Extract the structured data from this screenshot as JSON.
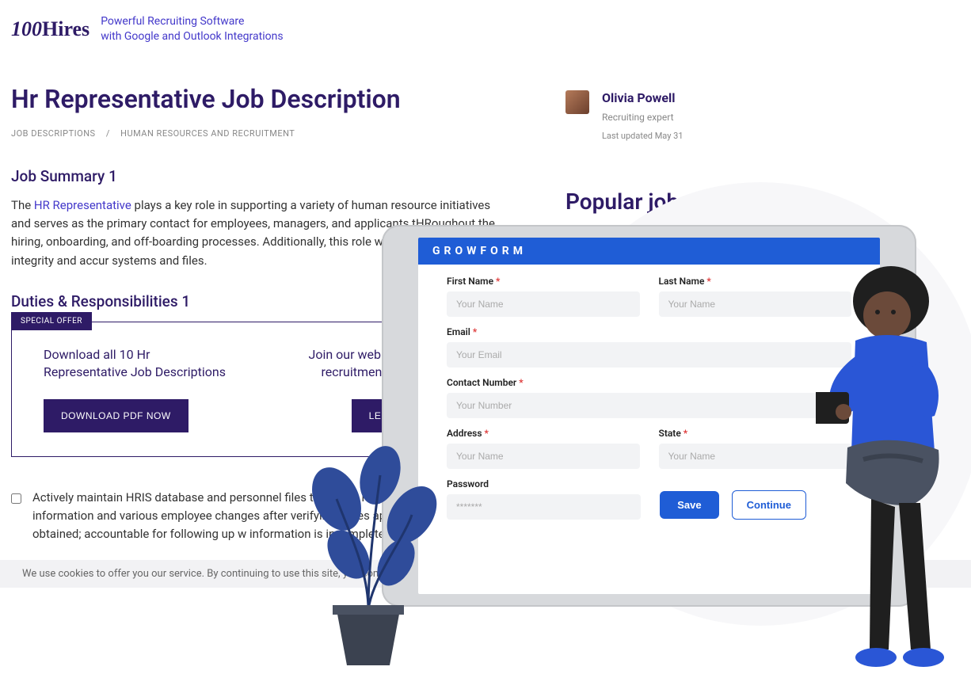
{
  "logo": {
    "text": "100Hires"
  },
  "tagline_l1": "Powerful Recruiting Software",
  "tagline_l2": "with Google and Outlook Integrations",
  "page_title": "Hr Representative Job Description",
  "breadcrumb": {
    "a": "JOB DESCRIPTIONS",
    "sep": "/",
    "b": "HUMAN RESOURCES AND RECRUITMENT"
  },
  "summary_h": "Job Summary 1",
  "summary_pre": "The ",
  "summary_link": "HR Representative",
  "summary_post": " plays a key role in supporting a variety of human resource initiatives and serves as the primary contact for employees, managers, and applicants tHRoughout the hiring, onboarding, and off-boarding processes. Additionally, this role works to ensure data integrity and accur systems and files.",
  "duties_h": "Duties & Responsibilities 1",
  "offer": {
    "badge": "SPECIAL OFFER",
    "left_head": "Download all 10 Hr Representative Job Descriptions",
    "left_btn": "DOWNLOAD PDF NOW",
    "right_head": "Join our webinar: How t recruitment strateg",
    "right_btn": "LE"
  },
  "duty1": "Actively maintain HRIS database and personnel files to ensure reco employee information and various employee changes after verifying neces approvals have been obtained; accountable for following up w information is incomplete.",
  "author": {
    "name": "Olivia Powell",
    "role": "Recruiting expert",
    "date": "Last updated May 31"
  },
  "popular_h": "Popular job descri",
  "cookie": "We use cookies to offer you our service. By continuing to use this site, you consent to",
  "form": {
    "brand": "GROWFORM",
    "first_name": {
      "label": "First Name",
      "ph": "Your Name"
    },
    "last_name": {
      "label": "Last Name",
      "ph": "Your Name"
    },
    "email": {
      "label": "Email",
      "ph": "Your Email"
    },
    "contact": {
      "label": "Contact  Number",
      "ph": "Your Number"
    },
    "address": {
      "label": "Address",
      "ph": "Your Name"
    },
    "state": {
      "label": "State",
      "ph": "Your Name"
    },
    "password": {
      "label": "Password",
      "ph": "*******"
    },
    "save": "Save",
    "continue": "Continue"
  }
}
